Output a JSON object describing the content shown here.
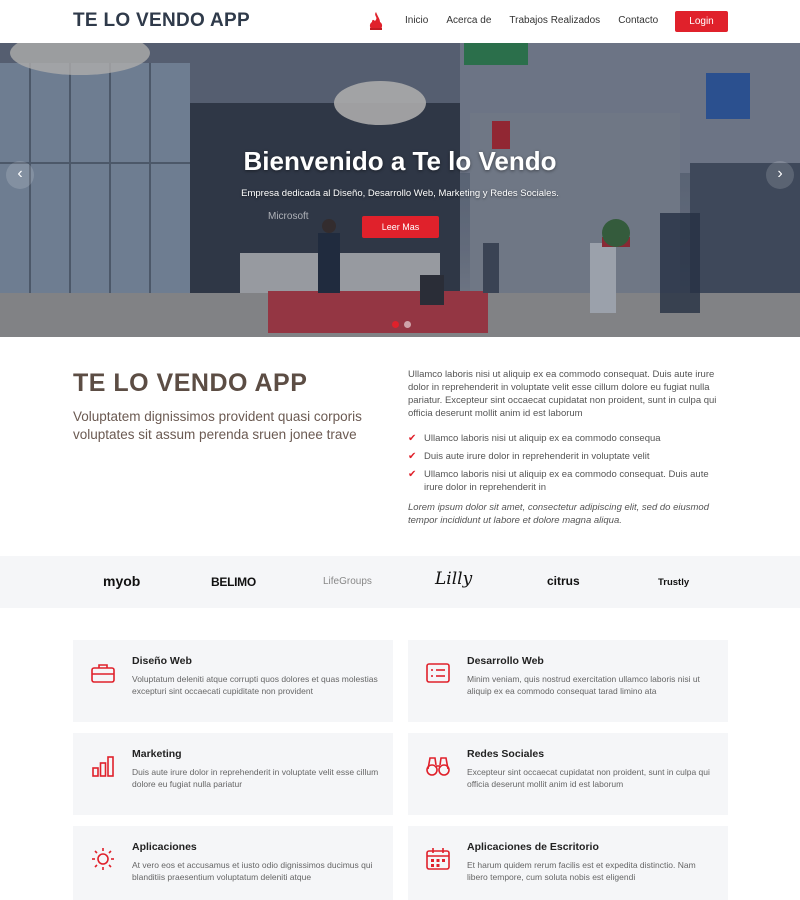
{
  "header": {
    "brand": "TE LO VENDO APP",
    "nav": [
      "Inicio",
      "Acerca de",
      "Trabajos Realizados",
      "Contacto"
    ],
    "login": "Login"
  },
  "hero": {
    "title": "Bienvenido a Te lo Vendo",
    "subtitle": "Empresa dedicada al Diseño, Desarrollo Web, Marketing y Redes Sociales.",
    "button": "Leer Mas",
    "prev_icon": "chevron-left-icon",
    "next_icon": "chevron-right-icon",
    "slides_count": 2,
    "active_slide": 1,
    "scene_sign": "Microsoft"
  },
  "about": {
    "title": "TE LO VENDO APP",
    "subtitle": "Voluptatem dignissimos provident quasi corporis voluptates sit assum perenda sruen jonee trave",
    "paragraph": "Ullamco laboris nisi ut aliquip ex ea commodo consequat. Duis aute irure dolor in reprehenderit in voluptate velit esse cillum dolore eu fugiat nulla pariatur. Excepteur sint occaecat cupidatat non proident, sunt in culpa qui officia deserunt mollit anim id est laborum",
    "list": [
      "Ullamco laboris nisi ut aliquip ex ea commodo consequa",
      "Duis aute irure dolor in reprehenderit in voluptate velit",
      "Ullamco laboris nisi ut aliquip ex ea commodo consequat. Duis aute irure dolor in reprehenderit in"
    ],
    "check_mark": "✔",
    "italic": "Lorem ipsum dolor sit amet, consectetur adipiscing elit, sed do eiusmod tempor incididunt ut labore et dolore magna aliqua."
  },
  "clients": [
    "myob",
    "BELIMO",
    "LifeGroups",
    "Lilly",
    "citrus",
    "Trustly"
  ],
  "services": [
    {
      "title": "Diseño Web",
      "text": "Voluptatum deleniti atque corrupti quos dolores et quas molestias excepturi sint occaecati cupiditate non provident",
      "icon": "briefcase-icon"
    },
    {
      "title": "Desarrollo Web",
      "text": "Minim veniam, quis nostrud exercitation ullamco laboris nisi ut aliquip ex ea commodo consequat tarad limino ata",
      "icon": "card-list-icon"
    },
    {
      "title": "Marketing",
      "text": "Duis aute irure dolor in reprehenderit in voluptate velit esse cillum dolore eu fugiat nulla pariatur",
      "icon": "bar-chart-icon"
    },
    {
      "title": "Redes Sociales",
      "text": "Excepteur sint occaecat cupidatat non proident, sunt in culpa qui officia deserunt mollit anim id est laborum",
      "icon": "binoculars-icon"
    },
    {
      "title": "Aplicaciones",
      "text": "At vero eos et accusamus et iusto odio dignissimos ducimus qui blanditiis praesentium voluptatum deleniti atque",
      "icon": "brightness-icon"
    },
    {
      "title": "Aplicaciones de Escritorio",
      "text": "Et harum quidem rerum facilis est et expedita distinctio. Nam libero tempore, cum soluta nobis est eligendi",
      "icon": "calendar-icon"
    }
  ],
  "colors": {
    "accent": "#e0212b",
    "brand_text": "#2f3a4a",
    "about_title": "#5c4d44",
    "card_bg": "#f5f6f8"
  }
}
